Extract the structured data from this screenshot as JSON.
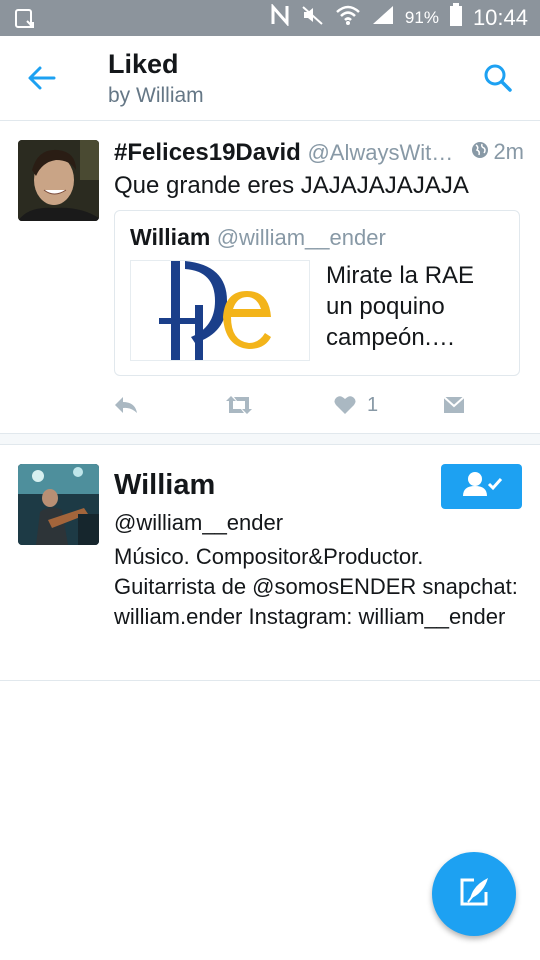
{
  "status_bar": {
    "battery_percent": "91%",
    "time": "10:44"
  },
  "header": {
    "title": "Liked",
    "subtitle": "by William"
  },
  "tweet": {
    "author_name": "#Felices19David",
    "author_handle": "@AlwaysWit…",
    "time": "2m",
    "text": "Que grande eres JAJAJAJAJAJA",
    "quote": {
      "author_name": "William",
      "author_handle": "@william__ender",
      "text": "Mirate la RAE un poquino campeón.…"
    },
    "like_count": "1"
  },
  "user_card": {
    "name": "William",
    "handle": "@william__ender",
    "bio": "Músico.  Compositor&Productor. Guitarrista de @somosENDER snapchat: william.ender Instagram: william__ender"
  },
  "colors": {
    "accent": "#1da1f2",
    "status_bar": "#8c949c",
    "secondary_text": "#8899a6"
  }
}
